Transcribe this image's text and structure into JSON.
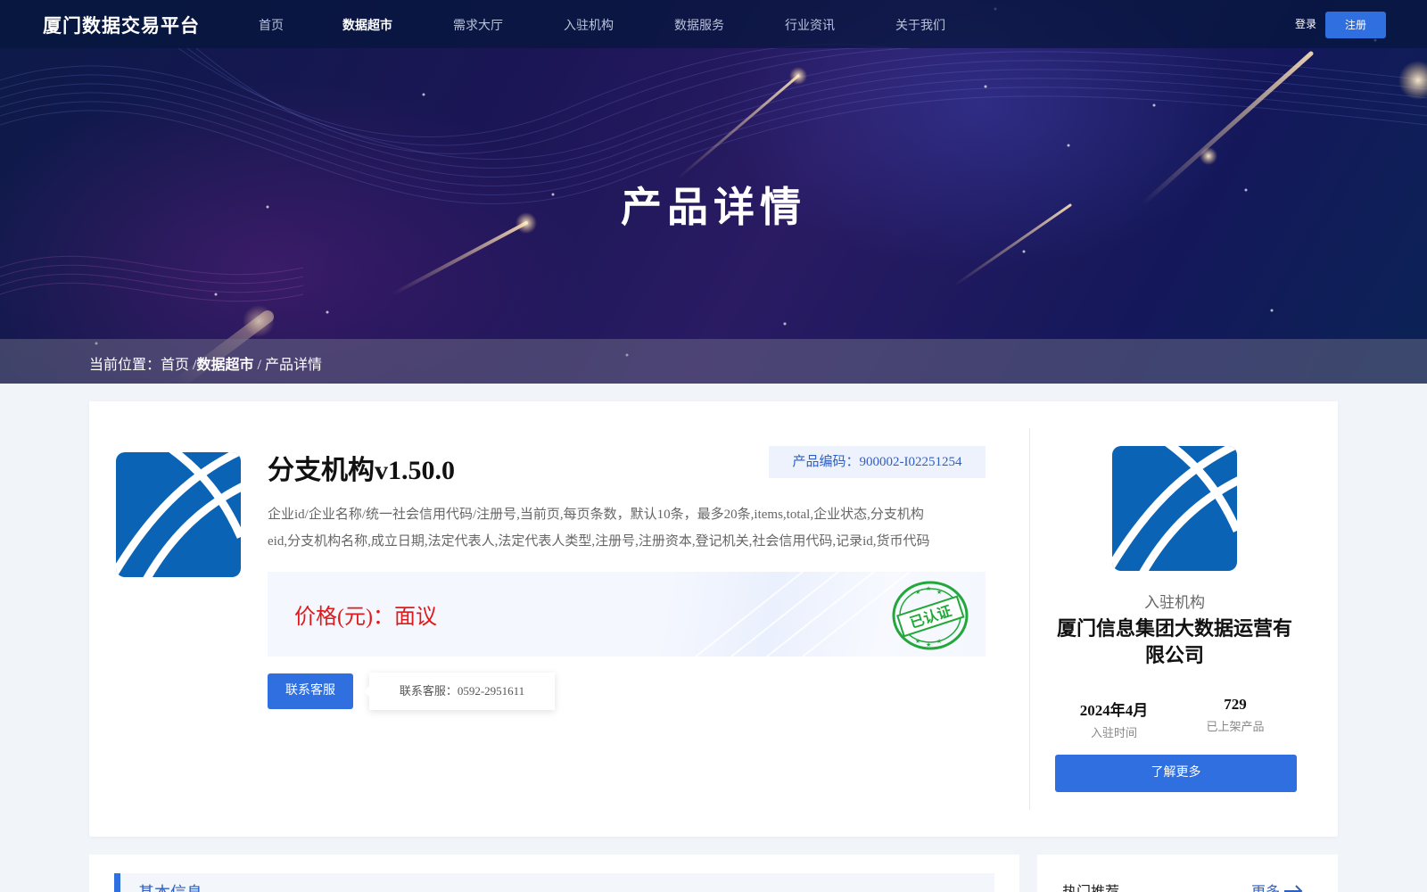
{
  "nav": {
    "logo": "厦门数据交易平台",
    "items": [
      {
        "label": "首页",
        "active": false
      },
      {
        "label": "数据超市",
        "active": true
      },
      {
        "label": "需求大厅",
        "active": false
      },
      {
        "label": "入驻机构",
        "active": false
      },
      {
        "label": "数据服务",
        "active": false
      },
      {
        "label": "行业资讯",
        "active": false
      },
      {
        "label": "关于我们",
        "active": false
      }
    ],
    "login": "登录",
    "register": "注册"
  },
  "hero": {
    "title": "产品详情"
  },
  "breadcrumb": {
    "prefix": "当前位置：",
    "home": "首页",
    "sep1": "/",
    "current_section": "数据超市",
    "sep2": "/",
    "page": "产品详情"
  },
  "product": {
    "name": "分支机构v1.50.0",
    "code": "产品编码：900002-I02251254",
    "description_line1": "企业id/企业名称/统一社会信用代码/注册号,当前页,每页条数，默认10条，最多20条,items,total,企业状态,分支机构",
    "description_line2": "eid,分支机构名称,成立日期,法定代表人,法定代表人类型,注册号,注册资本,登记机关,社会信用代码,记录id,货币代码",
    "price": "价格(元)：面议",
    "cert_stamp": "已认证",
    "contact_button": "联系客服",
    "contact_popover": "联系客服：0592-2951611"
  },
  "organization": {
    "caption": "入驻机构",
    "name": "厦门信息集团大数据运营有限公司",
    "join_date": "2024年4月",
    "join_date_label": "入驻时间",
    "product_count": "729",
    "product_count_label": "已上架产品",
    "more_button": "了解更多"
  },
  "basic_info": {
    "title": "基本信息"
  },
  "hot": {
    "title": "热门推荐",
    "more": "更多"
  },
  "colors": {
    "primary": "#2f6fe0",
    "price_red": "#e01a1a",
    "stamp_green": "#22a83a",
    "logo_blue": "#0b63b6"
  }
}
